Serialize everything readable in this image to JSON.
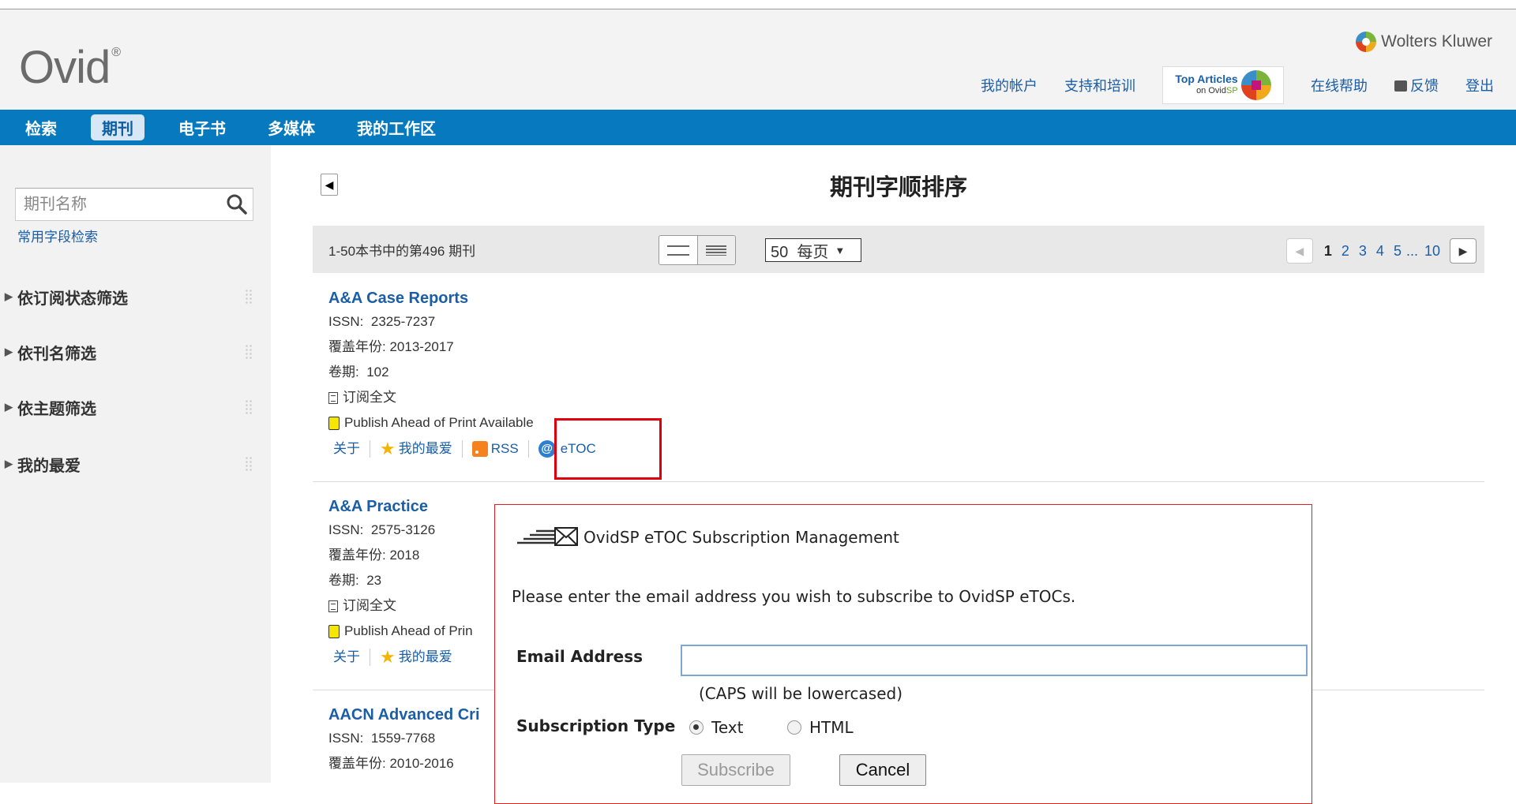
{
  "header": {
    "logo": "Ovid",
    "logo_mark": "®",
    "brand": "Wolters Kluwer",
    "links": {
      "account": "我的帐户",
      "support": "支持和培训",
      "top_articles_line1": "Top Articles",
      "top_articles_line2_prefix": "on Ovid",
      "top_articles_line2_suffix": "SP",
      "help": "在线帮助",
      "feedback": "反馈",
      "logout": "登出"
    }
  },
  "nav": {
    "items": [
      "检索",
      "期刊",
      "电子书",
      "多媒体",
      "我的工作区"
    ],
    "active": "期刊"
  },
  "sidebar": {
    "search_placeholder": "期刊名称",
    "search_value": "",
    "adv_search": "常用字段检索",
    "filters": [
      "依订阅状态筛选",
      "依刊名筛选",
      "依主题筛选",
      "我的最爱"
    ]
  },
  "main": {
    "title": "期刊字顺排序",
    "result_count": "1-50本书中的第496 期刊",
    "per_page": "50  每页",
    "pages": [
      "1",
      "2",
      "3",
      "4",
      "5"
    ],
    "ellipsis": "...",
    "last_page": "10",
    "labels": {
      "issn": "ISSN:",
      "coverage": "覆盖年份:",
      "volume": "卷期:",
      "subscribe": "订阅全文",
      "pap": "Publish Ahead of Print Available",
      "pap_cut": "Publish Ahead of Prin",
      "about": "关于",
      "favorite": "我的最爱",
      "rss": "RSS",
      "etoc": "eTOC"
    },
    "journals": [
      {
        "title": "A&A Case Reports",
        "issn": "2325-7237",
        "coverage": "2013-2017",
        "volume": "102"
      },
      {
        "title": "A&A Practice",
        "issn": "2575-3126",
        "coverage": "2018",
        "volume": "23"
      },
      {
        "title": "AACN Advanced Cri",
        "issn": "1559-7768",
        "coverage": "2010-2016"
      }
    ]
  },
  "modal": {
    "title": "OvidSP eTOC Subscription Management",
    "description": "Please enter the email address you wish to subscribe to OvidSP eTOCs.",
    "email_label": "Email Address",
    "email_value": "",
    "caps_note": "(CAPS will be lowercased)",
    "type_label": "Subscription Type",
    "type_options": [
      "Text",
      "HTML"
    ],
    "type_selected": "Text",
    "subscribe_btn": "Subscribe",
    "cancel_btn": "Cancel"
  },
  "colors": {
    "nav_bg": "#0779bf",
    "link": "#1a5ea8",
    "highlight": "#e0000b",
    "modal_border": "#e02020"
  }
}
